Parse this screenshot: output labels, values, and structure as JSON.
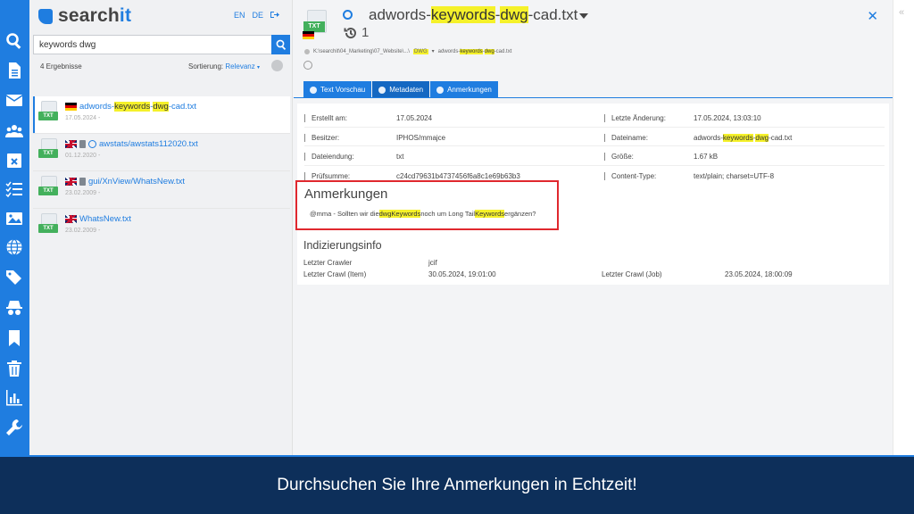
{
  "app": {
    "logo_prefix": "search",
    "logo_suffix": "it",
    "lang_en": "EN",
    "lang_de": "DE"
  },
  "rail_icons": [
    "search-icon",
    "document-icon",
    "mail-icon",
    "users-icon",
    "calendar-icon",
    "checklist-icon",
    "image-icon",
    "globe-icon",
    "tags-icon",
    "spy-icon",
    "bookmark-icon",
    "trash-icon",
    "chart-icon",
    "wrench-icon"
  ],
  "search": {
    "value": "keywords dwg",
    "count": "4 Ergebnisse",
    "sort_label": "Sortierung:",
    "sort_value": "Relevanz"
  },
  "results": [
    {
      "file_tag": "TXT",
      "flag": "de",
      "parts": [
        "adwords-",
        "keywords",
        "-",
        "dwg",
        "-cad.txt"
      ],
      "date": "17.05.2024 -"
    },
    {
      "file_tag": "TXT",
      "flag": "gb",
      "path": "awstats/awstats112020.txt",
      "date": "01.12.2020 -"
    },
    {
      "file_tag": "TXT",
      "flag": "gb",
      "path": "gui/XnView/WhatsNew.txt",
      "date": "23.02.2009 -"
    },
    {
      "file_tag": "TXT",
      "flag": "gb",
      "path": "WhatsNew.txt",
      "date": "23.02.2009 -"
    }
  ],
  "detail": {
    "file_tag": "TXT",
    "title_parts": [
      "adwords-",
      "keywords",
      "-",
      "dwg",
      "-cad.txt"
    ],
    "version": "1",
    "path_prefix": "K:\\searchit\\04_Marketing\\07_Website\\...\\",
    "path_dir": "DWG",
    "path_file_parts": [
      "adwords-",
      "keywords",
      "-",
      "dwg",
      "-cad.txt"
    ],
    "tabs": [
      "Text Vorschau",
      "Metadaten",
      "Anmerkungen"
    ],
    "active_tab": "Metadaten"
  },
  "metadata": [
    {
      "k1": "Erstellt am:",
      "v1": "17.05.2024",
      "k2": "Letzte Änderung:",
      "v2": "17.05.2024, 13:03:10"
    },
    {
      "k1": "Besitzer:",
      "v1": "IPHOS/mmajce",
      "k2": "Dateiname:",
      "v2_parts": [
        "adwords-",
        "keywords",
        "-",
        "dwg",
        "-cad.txt"
      ]
    },
    {
      "k1": "Dateiendung:",
      "v1": "txt",
      "k2": "Größe:",
      "v2": "1.67 kB"
    },
    {
      "k1": "Prüfsumme:",
      "v1": "c24cd79631b4737456f6a8c1e69b63b3",
      "k2": "Content-Type:",
      "v2": "text/plain; charset=UTF-8"
    }
  ],
  "annotation": {
    "heading": "Anmerkungen",
    "text_parts": [
      "@mma - Sollten wir die",
      "dwgKeywords",
      "noch um Long Tail",
      "Keywords",
      "ergänzen?"
    ]
  },
  "indexing": {
    "heading": "Indizierungsinfo",
    "last_crawler_label": "Letzter Crawler",
    "last_crawler_value": "jcif",
    "last_crawl_item_label": "Letzter Crawl (Item)",
    "last_crawl_item_value": "30.05.2024, 19:01:00",
    "last_crawl_job_label": "Letzter Crawl (Job)",
    "last_crawl_job_value": "23.05.2024, 18:00:09"
  },
  "banner": "Durchsuchen Sie Ihre Anmerkungen in Echtzeit!"
}
